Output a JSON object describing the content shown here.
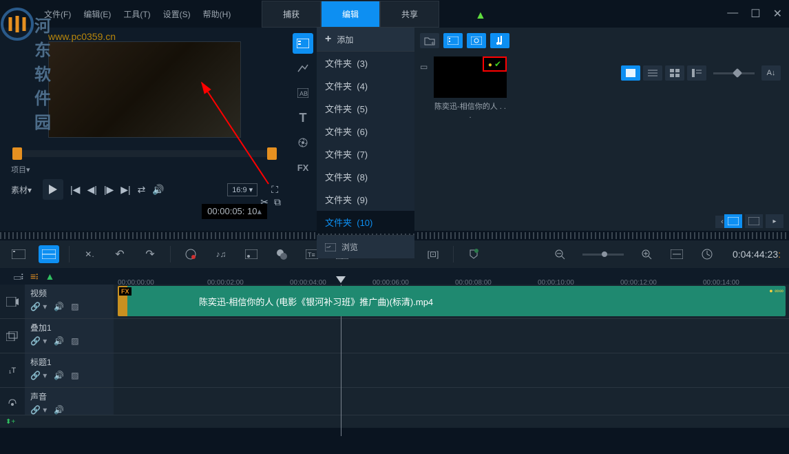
{
  "watermark": {
    "text": "河东软件园",
    "url": "www.pc0359.cn"
  },
  "menu": {
    "file": "文件(F)",
    "edit": "编辑(E)",
    "tools": "工具(T)",
    "settings": "设置(S)",
    "help": "帮助(H)"
  },
  "tabs": {
    "capture": "捕获",
    "edit": "编辑",
    "share": "共享"
  },
  "preview": {
    "project_label": "项目▾",
    "material_label": "素材▾",
    "aspect": "16:9 ▾",
    "timecode": "00:00:05: 10"
  },
  "library": {
    "sidebar_icons": [
      "media",
      "transition",
      "title",
      "text",
      "overlay",
      "effect",
      "fx"
    ],
    "add_label": "添加",
    "browse_label": "浏览",
    "folders": [
      {
        "name": "文件夹",
        "count": "(3)"
      },
      {
        "name": "文件夹",
        "count": "(4)"
      },
      {
        "name": "文件夹",
        "count": "(5)"
      },
      {
        "name": "文件夹",
        "count": "(6)"
      },
      {
        "name": "文件夹",
        "count": "(7)"
      },
      {
        "name": "文件夹",
        "count": "(8)"
      },
      {
        "name": "文件夹",
        "count": "(9)"
      },
      {
        "name": "文件夹",
        "count": "(10)"
      }
    ],
    "media_item": "陈奕迅-相信你的人 . . ."
  },
  "timeline": {
    "timecode": "0:04:44:23",
    "ruler": [
      "00:00:00:00",
      "00:00:02:00",
      "00:00:04:00",
      "00:00:06:00",
      "00:00:08:00",
      "00:00:10:00",
      "00:00:12:00",
      "00:00:14:00"
    ],
    "fx_label": "FX",
    "tracks": {
      "video": "视频",
      "overlay": "叠加1",
      "title": "标题1",
      "audio": "声音"
    },
    "clip_name": "陈奕迅-相信你的人 (电影《银河补习班》推广曲)(标清).mp4"
  },
  "fx_text": "FX"
}
